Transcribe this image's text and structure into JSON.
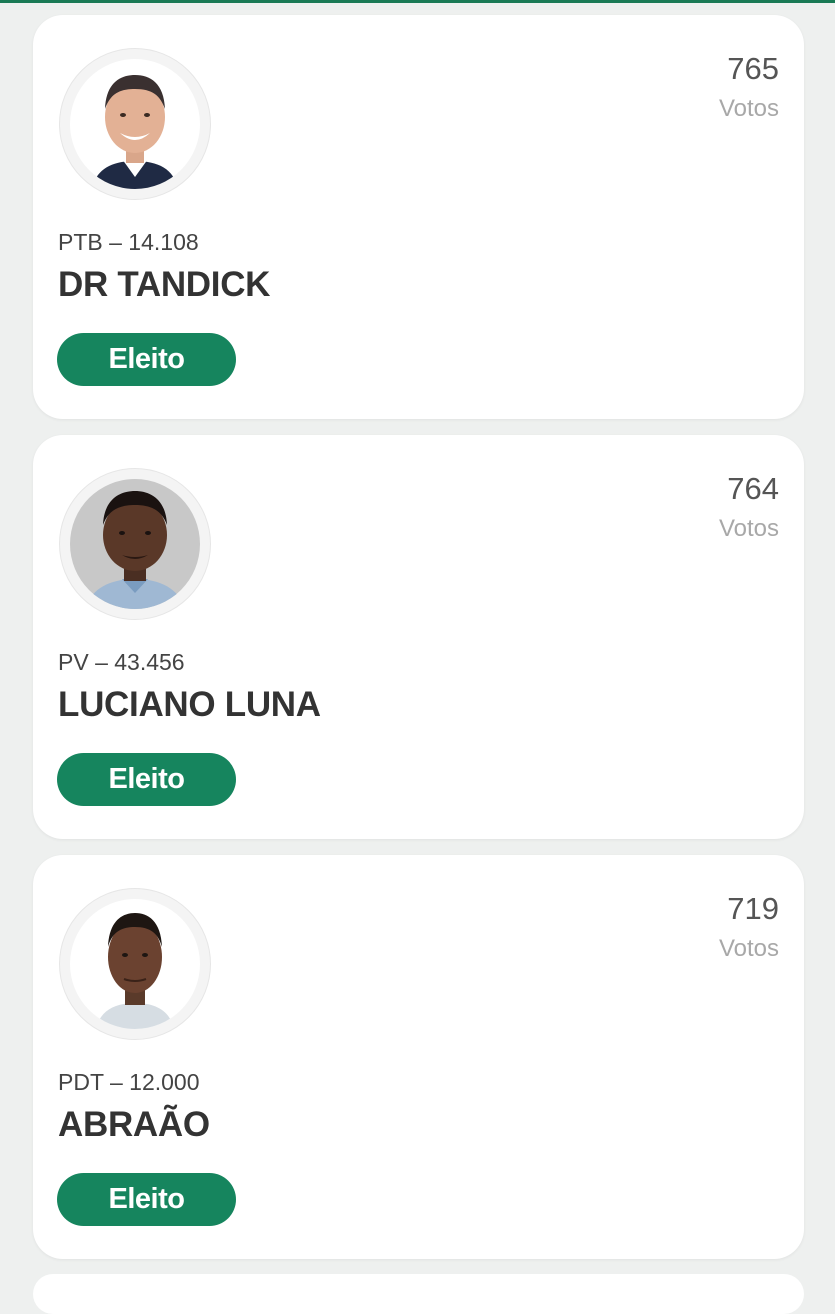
{
  "colors": {
    "accent": "#16855e",
    "top_bar": "#1a7a55",
    "background": "#eef0ef",
    "card": "#ffffff"
  },
  "candidates": [
    {
      "votes": "765",
      "votes_label": "Votos",
      "party_line": "PTB – 14.108",
      "name": "DR TANDICK",
      "status": "Eleito",
      "photo_icon": "candidate-photo-icon"
    },
    {
      "votes": "764",
      "votes_label": "Votos",
      "party_line": "PV – 43.456",
      "name": "LUCIANO LUNA",
      "status": "Eleito",
      "photo_icon": "candidate-photo-icon"
    },
    {
      "votes": "719",
      "votes_label": "Votos",
      "party_line": "PDT – 12.000",
      "name": "ABRAÃO",
      "status": "Eleito",
      "photo_icon": "candidate-photo-icon"
    }
  ]
}
